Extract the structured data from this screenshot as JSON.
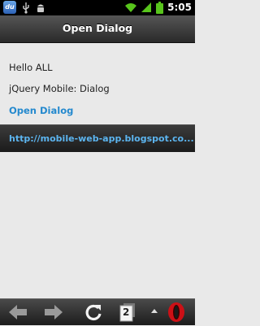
{
  "status_bar": {
    "app_icon_text": "du",
    "time": "5:05",
    "icons": [
      "app-icon",
      "usb-icon",
      "android-debug-icon",
      "wifi-icon",
      "signal-icon",
      "battery-icon"
    ]
  },
  "header": {
    "title": "Open Dialog"
  },
  "content": {
    "line1": "Hello ALL",
    "line2": "jQuery Mobile: Dialog",
    "open_dialog_link": "Open Dialog"
  },
  "footer": {
    "link": "http://mobile-web-app.blogspot.co..."
  },
  "browser_toolbar": {
    "tabs_count": "2",
    "icons": [
      "back-arrow-icon",
      "forward-arrow-icon",
      "reload-icon",
      "tabs-icon",
      "menu-up-icon",
      "opera-logo-icon"
    ]
  },
  "colors": {
    "link_blue": "#2489ce",
    "footer_link_blue": "#5cb5f0",
    "opera_red": "#cc1016"
  }
}
